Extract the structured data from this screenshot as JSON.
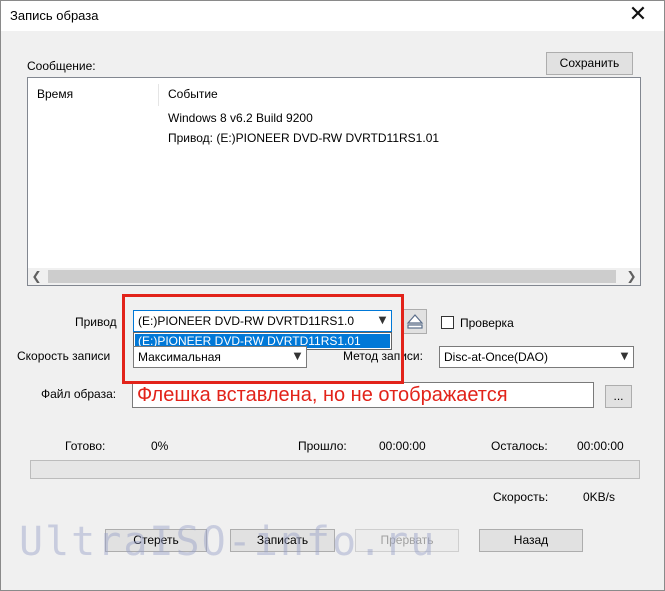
{
  "window": {
    "title": "Запись образа",
    "close_symbol": "✕"
  },
  "message": {
    "label": "Сообщение:",
    "save_button": "Сохранить",
    "columns": [
      "Время",
      "Событие"
    ],
    "rows": [
      {
        "time": "",
        "event": "Windows 8 v6.2 Build 9200"
      },
      {
        "time": "",
        "event": "Привод: (E:)PIONEER DVD-RW DVRTD11RS1.01"
      }
    ]
  },
  "drive": {
    "label": "Привод",
    "selected": "(E:)PIONEER DVD-RW DVRTD11RS1.0",
    "options": [
      "(E:)PIONEER DVD-RW DVRTD11RS1.01"
    ],
    "verify_label": "Проверка"
  },
  "speed": {
    "label": "Скорость записи",
    "value": "Максимальная"
  },
  "method": {
    "label": "Метод записи:",
    "value": "Disc-at-Once(DAO)"
  },
  "image_file": {
    "label": "Файл образа:",
    "value": "",
    "browse_button": "..."
  },
  "status": {
    "ready_label": "Готово:",
    "ready_value": "0%",
    "elapsed_label": "Прошло:",
    "elapsed_value": "00:00:00",
    "remaining_label": "Осталось:",
    "remaining_value": "00:00:00",
    "speed_label": "Скорость:",
    "speed_value": "0KB/s",
    "progress": 0
  },
  "buttons": {
    "erase": "Стереть",
    "write": "Записать",
    "abort": "Прервать",
    "back": "Назад"
  },
  "annotation": {
    "text": "Флешка вставлена, но не отображается",
    "color": "#e2231a"
  },
  "watermark": "UltraISO-info.ru"
}
